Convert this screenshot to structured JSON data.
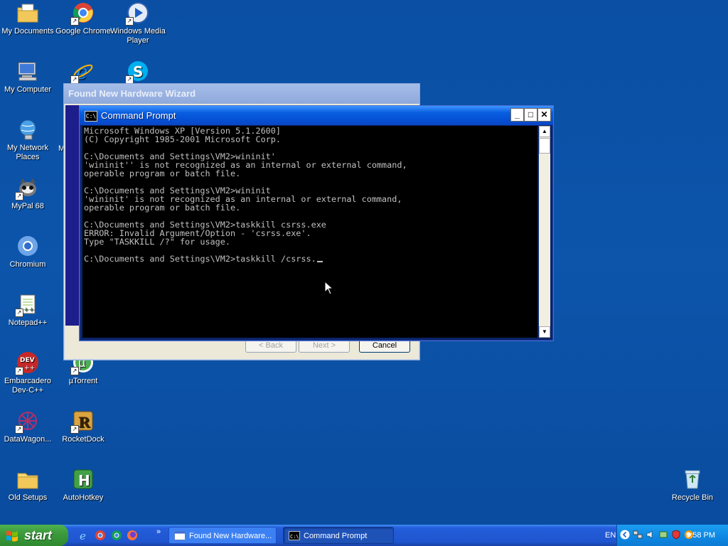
{
  "desktop": {
    "icons": [
      {
        "label": "My Documents",
        "icon": "folder-documents-icon"
      },
      {
        "label": "Google Chrome",
        "icon": "chrome-icon"
      },
      {
        "label": "Windows Media Player",
        "icon": "media-player-icon"
      },
      {
        "label": "My Computer",
        "icon": "computer-icon"
      },
      {
        "label": "My Network Places",
        "icon": "network-icon"
      },
      {
        "label": "MyPal 68",
        "icon": "mypal-icon"
      },
      {
        "label": "Chromium",
        "icon": "chromium-icon"
      },
      {
        "label": "Notepad++",
        "icon": "notepadpp-icon"
      },
      {
        "label": "Embarcadero Dev-C++",
        "icon": "devcpp-icon"
      },
      {
        "label": "µTorrent",
        "icon": "utorrent-icon"
      },
      {
        "label": "DataWagon...",
        "icon": "datawagon-icon"
      },
      {
        "label": "RocketDock",
        "icon": "rocketdock-icon"
      },
      {
        "label": "Old Setups",
        "icon": "folder-icon"
      },
      {
        "label": "AutoHotkey",
        "icon": "autohotkey-icon"
      },
      {
        "label": "Recycle Bin",
        "icon": "recycle-bin-icon"
      }
    ],
    "partial_label": "M"
  },
  "wizard": {
    "title": "Found New Hardware Wizard",
    "back_label": "< Back",
    "next_label": "Next >",
    "cancel_label": "Cancel"
  },
  "cmd": {
    "title": "Command Prompt",
    "icon_text": "C:\\",
    "minimize": "_",
    "maximize": "□",
    "close": "✕",
    "lines": [
      "Microsoft Windows XP [Version 5.1.2600]",
      "(C) Copyright 1985-2001 Microsoft Corp.",
      "",
      "C:\\Documents and Settings\\VM2>wininit'",
      "'wininit'' is not recognized as an internal or external command,",
      "operable program or batch file.",
      "",
      "C:\\Documents and Settings\\VM2>wininit",
      "'wininit' is not recognized as an internal or external command,",
      "operable program or batch file.",
      "",
      "C:\\Documents and Settings\\VM2>taskkill csrss.exe",
      "ERROR: Invalid Argument/Option - 'csrss.exe'.",
      "Type \"TASKKILL /?\" for usage.",
      "",
      "C:\\Documents and Settings\\VM2>taskkill /csrss."
    ]
  },
  "taskbar": {
    "start_label": "start",
    "quicklaunch": [
      "ie-icon",
      "chrome-icon",
      "chrome-icon",
      "firefox-icon"
    ],
    "overflow": "»",
    "tasks": [
      {
        "label": "Found New Hardware...",
        "active": false
      },
      {
        "label": "Command Prompt",
        "active": true
      }
    ],
    "language": "EN",
    "tray_icons": [
      "chevron-left-icon",
      "network-icon",
      "speaker-icon",
      "safely-remove-icon",
      "security-icon",
      "sync-icon"
    ],
    "clock": "9:58 PM"
  },
  "colors": {
    "desktop": "#0b50a6",
    "title_bar": "#0451d6",
    "start_button": "#3c9a3c",
    "console_bg": "#000000",
    "console_text": "#c0c0c0"
  }
}
